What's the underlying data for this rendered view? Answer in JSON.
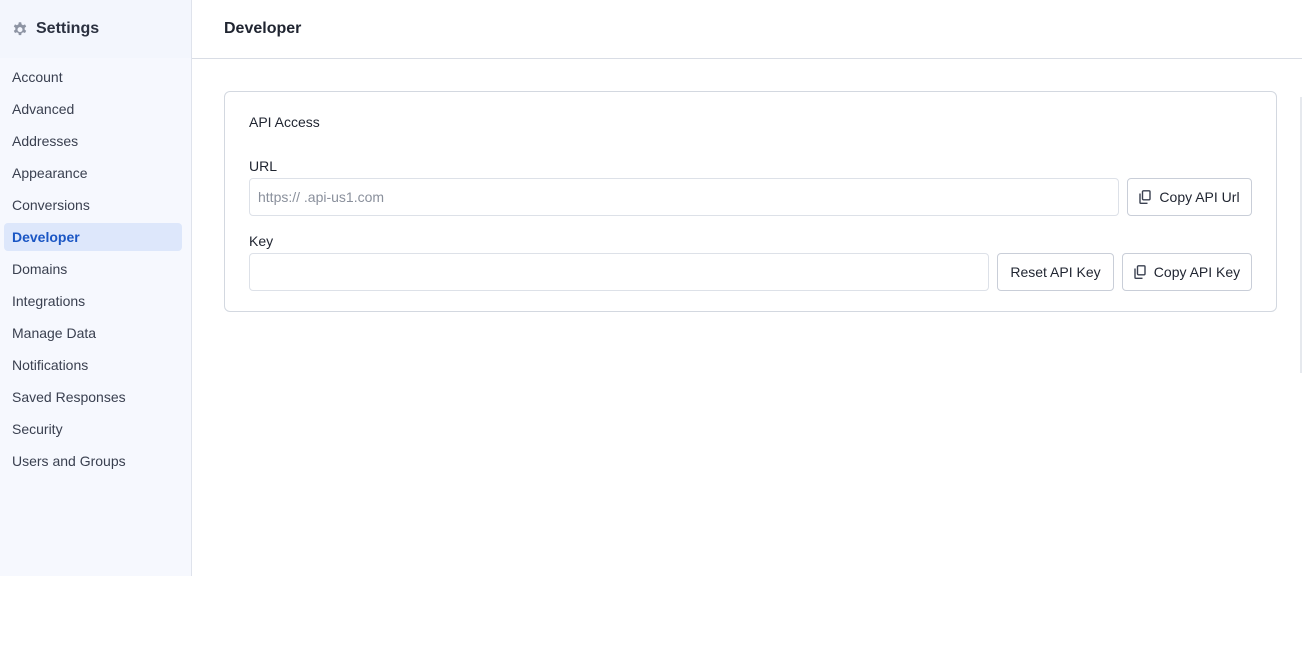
{
  "sidebar": {
    "title": "Settings",
    "title_icon": "gear-icon",
    "items": [
      {
        "label": "Account",
        "active": false
      },
      {
        "label": "Advanced",
        "active": false
      },
      {
        "label": "Addresses",
        "active": false
      },
      {
        "label": "Appearance",
        "active": false
      },
      {
        "label": "Conversions",
        "active": false
      },
      {
        "label": "Developer",
        "active": true
      },
      {
        "label": "Domains",
        "active": false
      },
      {
        "label": "Integrations",
        "active": false
      },
      {
        "label": "Manage Data",
        "active": false
      },
      {
        "label": "Notifications",
        "active": false
      },
      {
        "label": "Saved Responses",
        "active": false
      },
      {
        "label": "Security",
        "active": false
      },
      {
        "label": "Users and Groups",
        "active": false
      }
    ]
  },
  "header": {
    "title": "Developer"
  },
  "api_access": {
    "title": "API Access",
    "url_label": "URL",
    "url_value": "https://                    .api-us1.com",
    "copy_url_label": "Copy API Url",
    "key_label": "Key",
    "key_value": "",
    "reset_key_label": "Reset API Key",
    "copy_key_label": "Copy API Key",
    "copy_icon": "copy-icon"
  },
  "colors": {
    "accent": "#1a56c4",
    "active_bg": "#dde7fb",
    "sidebar_bg": "#f6f8fe"
  }
}
